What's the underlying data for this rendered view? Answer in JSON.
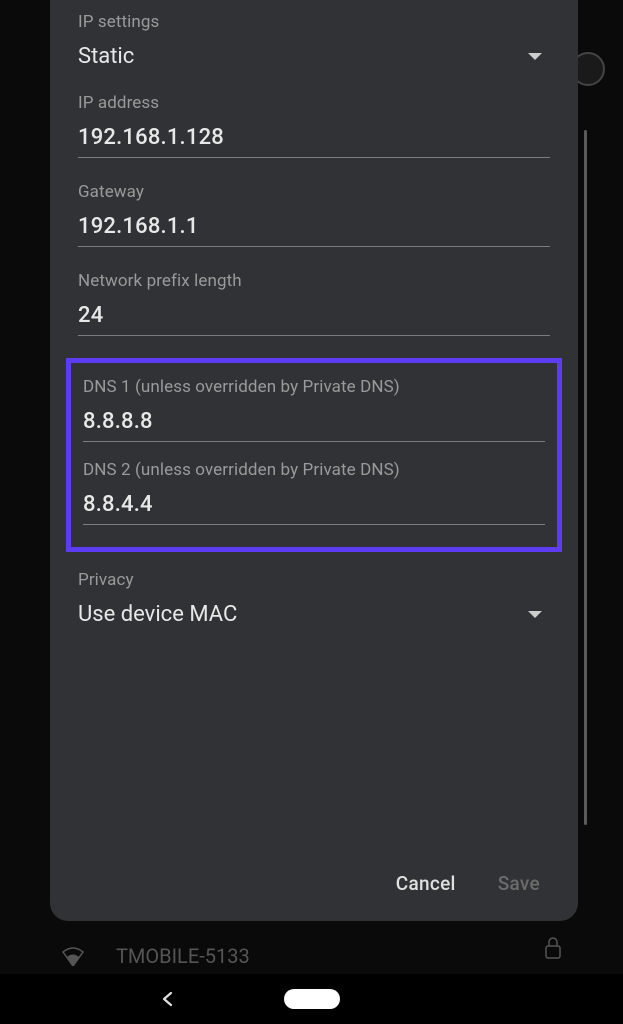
{
  "dialog": {
    "ip_settings": {
      "label": "IP settings",
      "value": "Static"
    },
    "ip_address": {
      "label": "IP address",
      "value": "192.168.1.128"
    },
    "gateway": {
      "label": "Gateway",
      "value": "192.168.1.1"
    },
    "prefix_length": {
      "label": "Network prefix length",
      "value": "24"
    },
    "dns1": {
      "label": "DNS 1 (unless overridden by Private DNS)",
      "value": "8.8.8.8"
    },
    "dns2": {
      "label": "DNS 2 (unless overridden by Private DNS)",
      "value": "8.8.4.4"
    },
    "privacy": {
      "label": "Privacy",
      "value": "Use device MAC"
    },
    "actions": {
      "cancel": "Cancel",
      "save": "Save"
    }
  },
  "background": {
    "wifi_name": "TMOBILE-5133"
  }
}
